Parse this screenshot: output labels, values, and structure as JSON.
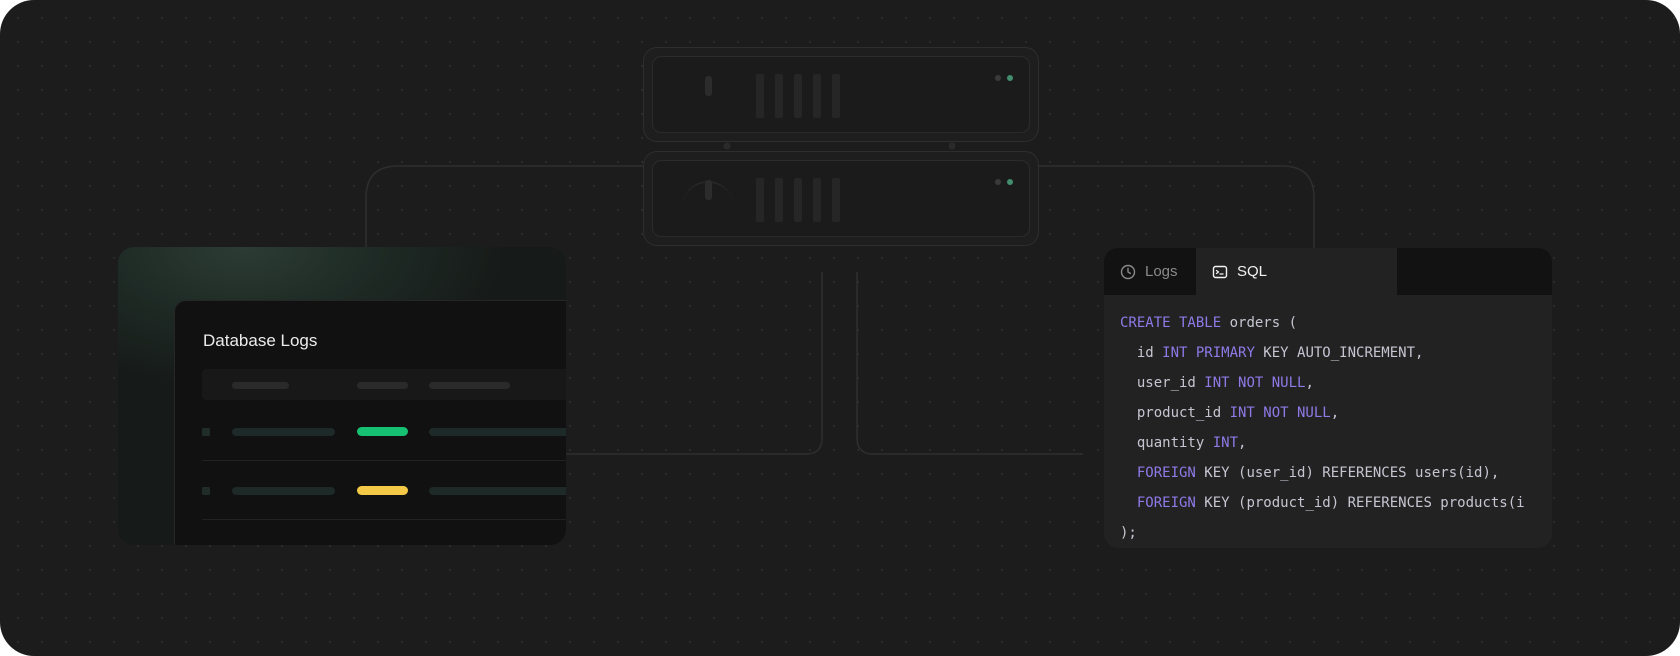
{
  "logs_panel": {
    "title": "Database Logs",
    "rows": [
      {
        "status_color": "#17c173"
      },
      {
        "status_color": "#f3c947"
      },
      {
        "status_color": "#17c173"
      }
    ]
  },
  "sql_panel": {
    "tabs": [
      {
        "label": "Logs",
        "icon": "clock-icon",
        "active": false
      },
      {
        "label": "SQL",
        "icon": "terminal-icon",
        "active": true
      }
    ],
    "code_lines": [
      [
        {
          "t": "CREATE TABLE",
          "kw": true
        },
        {
          "t": " orders ("
        }
      ],
      [
        {
          "t": "  id "
        },
        {
          "t": "INT PRIMARY",
          "kw": true
        },
        {
          "t": " KEY AUTO_INCREMENT,"
        }
      ],
      [
        {
          "t": "  user_id "
        },
        {
          "t": "INT NOT NULL",
          "kw": true
        },
        {
          "t": ","
        }
      ],
      [
        {
          "t": "  product_id "
        },
        {
          "t": "INT NOT NULL",
          "kw": true
        },
        {
          "t": ","
        }
      ],
      [
        {
          "t": "  quantity "
        },
        {
          "t": "INT",
          "kw": true
        },
        {
          "t": ","
        }
      ],
      [
        {
          "t": "  "
        },
        {
          "t": "FOREIGN",
          "kw": true
        },
        {
          "t": " KEY (user_id) REFERENCES users(id),"
        }
      ],
      [
        {
          "t": "  "
        },
        {
          "t": "FOREIGN",
          "kw": true
        },
        {
          "t": " KEY (product_id) REFERENCES products(i"
        }
      ],
      [
        {
          "t": ");"
        }
      ]
    ]
  },
  "colors": {
    "background": "#1c1c1c",
    "keyword": "#8f7ae8",
    "status_success": "#17c173",
    "status_warning": "#f3c947"
  }
}
